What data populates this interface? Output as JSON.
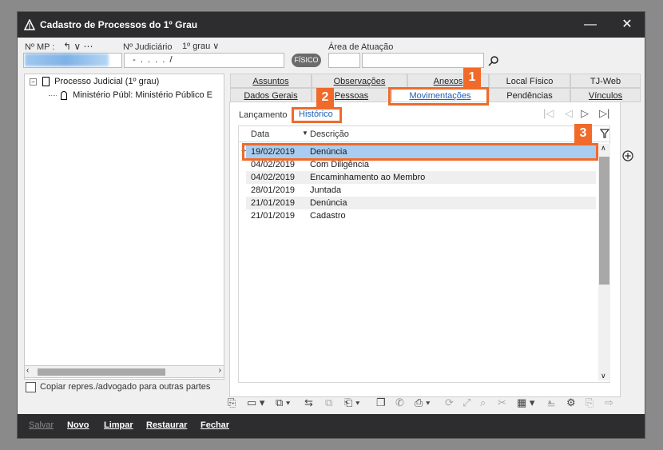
{
  "window": {
    "title": "Cadastro de Processos do 1º Grau",
    "minimize": "—",
    "close": "✕"
  },
  "header": {
    "nmp_label": "Nº MP :",
    "nmp_controls": "↰ ∨ ⋯",
    "judiciario_label": "Nº Judiciário",
    "grau_select": "1º grau ∨",
    "judiciario_value": "  -  .  .  .  .  /",
    "fisico_badge": "FÍSICO",
    "area_label": "Área de Atuação"
  },
  "tree": {
    "root": "Processo Judicial (1º grau)",
    "child": "Ministério Públ: Ministério Público E",
    "copy_checkbox_label": "Copiar repres./advogado para outras partes"
  },
  "tabs_row1": [
    "Assuntos",
    "Observações",
    "Anexos",
    "Local Físico",
    "TJ-Web"
  ],
  "tabs_row2": [
    "Dados Gerais",
    "Pessoas",
    "Movimentações",
    "Pendências",
    "Vínculos"
  ],
  "subtabs": [
    "Lançamento",
    "Histórico"
  ],
  "grid": {
    "columns": [
      "Data",
      "Descrição"
    ],
    "sort_marker": "▼",
    "current_marker": "→",
    "rows": [
      {
        "date": "19/02/2019",
        "desc": "Denúncia"
      },
      {
        "date": "04/02/2019",
        "desc": "Com Diligência"
      },
      {
        "date": "04/02/2019",
        "desc": "Encaminhamento ao Membro"
      },
      {
        "date": "28/01/2019",
        "desc": "Juntada"
      },
      {
        "date": "21/01/2019",
        "desc": "Denúncia"
      },
      {
        "date": "21/01/2019",
        "desc": "Cadastro"
      }
    ]
  },
  "callouts": [
    "1",
    "2",
    "3"
  ],
  "bottom": {
    "salvar": "Salvar",
    "novo": "Novo",
    "limpar": "Limpar",
    "restaurar": "Restaurar",
    "fechar": "Fechar"
  },
  "icons": {
    "accent": "#f06a2a",
    "selection": "#a9cdf0",
    "link": "#1c5fb8"
  }
}
